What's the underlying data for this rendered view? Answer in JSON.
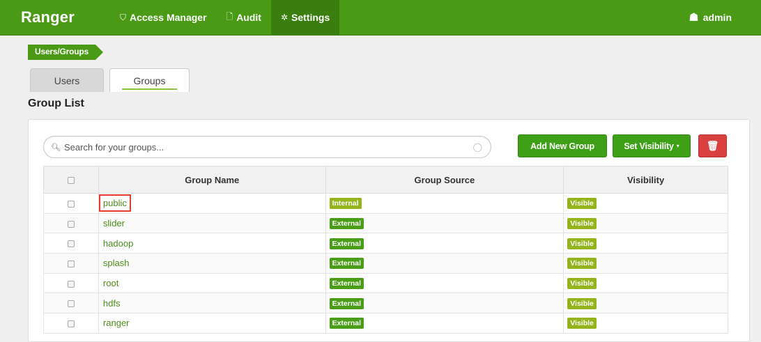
{
  "nav": {
    "brand": "Ranger",
    "items": [
      {
        "icon": "shield-icon",
        "glyph": "⛉",
        "label": "Access Manager",
        "active": false
      },
      {
        "icon": "document-icon",
        "glyph": "🗋",
        "label": "Audit",
        "active": false
      },
      {
        "icon": "gear-icon",
        "glyph": "✲",
        "label": "Settings",
        "active": true
      }
    ],
    "user": {
      "icon": "user-icon",
      "glyph": "☗",
      "label": "admin"
    }
  },
  "breadcrumb": "Users/Groups",
  "tabs": [
    {
      "label": "Users",
      "active": false
    },
    {
      "label": "Groups",
      "active": true
    }
  ],
  "section_title": "Group List",
  "search": {
    "placeholder": "Search for your groups...",
    "value": ""
  },
  "buttons": {
    "add_group": "Add New Group",
    "set_visibility": "Set Visibility",
    "caret": "▾",
    "delete_icon": "🗑"
  },
  "table": {
    "columns": [
      "Group Name",
      "Group Source",
      "Visibility"
    ],
    "rows": [
      {
        "name": "public",
        "source": "Internal",
        "visibility": "Visible",
        "highlighted": true
      },
      {
        "name": "slider",
        "source": "External",
        "visibility": "Visible"
      },
      {
        "name": "hadoop",
        "source": "External",
        "visibility": "Visible"
      },
      {
        "name": "splash",
        "source": "External",
        "visibility": "Visible"
      },
      {
        "name": "root",
        "source": "External",
        "visibility": "Visible"
      },
      {
        "name": "hdfs",
        "source": "External",
        "visibility": "Visible"
      },
      {
        "name": "ranger",
        "source": "External",
        "visibility": "Visible"
      }
    ]
  },
  "colors": {
    "navbar": "#4a9a16",
    "link": "#4a8f1a",
    "internal_badge": "#93b41d",
    "external_badge": "#4a9e17",
    "visible_badge": "#93b41d",
    "delete": "#d94040",
    "highlight_outline": "#e53b2a"
  }
}
